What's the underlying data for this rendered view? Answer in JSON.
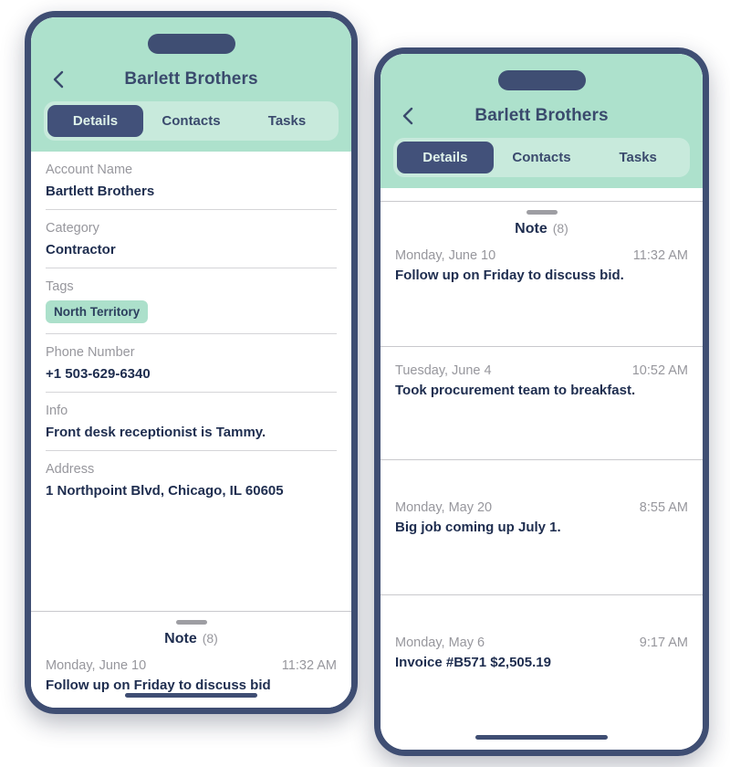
{
  "colors": {
    "header_green": "#ade1cc",
    "tab_track_green": "#c8eadc",
    "navy": "#3f4e73",
    "navy_text": "#1e2d4f",
    "muted_gray": "#97979d",
    "tag_green": "#ace0cb"
  },
  "phone_left": {
    "header": {
      "back_icon": "chevron-left-icon",
      "title": "Barlett Brothers"
    },
    "tabs": [
      {
        "label": "Details",
        "active": true
      },
      {
        "label": "Contacts",
        "active": false
      },
      {
        "label": "Tasks",
        "active": false
      }
    ],
    "details": [
      {
        "label": "Account Name",
        "value": "Bartlett Brothers",
        "type": "text"
      },
      {
        "label": "Category",
        "value": "Contractor",
        "type": "text"
      },
      {
        "label": "Tags",
        "value": "North Territory",
        "type": "tag"
      },
      {
        "label": "Phone Number",
        "value": "+1 503-629-6340",
        "type": "text"
      },
      {
        "label": "Info",
        "value": "Front desk receptionist is Tammy.",
        "type": "text"
      },
      {
        "label": "Address",
        "value": "1 Northpoint Blvd, Chicago, IL 60605",
        "type": "text"
      }
    ],
    "note_sheet": {
      "title": "Note",
      "count": "(8)",
      "notes": [
        {
          "date": "Monday, June 10",
          "time": "11:32 AM",
          "body": "Follow up on Friday to discuss bid"
        }
      ]
    }
  },
  "phone_right": {
    "header": {
      "back_icon": "chevron-left-icon",
      "title": "Barlett Brothers"
    },
    "tabs": [
      {
        "label": "Details",
        "active": true
      },
      {
        "label": "Contacts",
        "active": false
      },
      {
        "label": "Tasks",
        "active": false
      }
    ],
    "note_sheet": {
      "title": "Note",
      "count": "(8)",
      "notes": [
        {
          "date": "Monday, June 10",
          "time": "11:32 AM",
          "body": "Follow up on Friday to discuss bid."
        },
        {
          "date": "Tuesday, June 4",
          "time": "10:52 AM",
          "body": "Took procurement team to breakfast."
        },
        {
          "date": "Monday, May 20",
          "time": "8:55 AM",
          "body": "Big job coming up July 1."
        },
        {
          "date": "Monday, May 6",
          "time": "9:17 AM",
          "body": "Invoice #B571 $2,505.19"
        }
      ]
    }
  }
}
